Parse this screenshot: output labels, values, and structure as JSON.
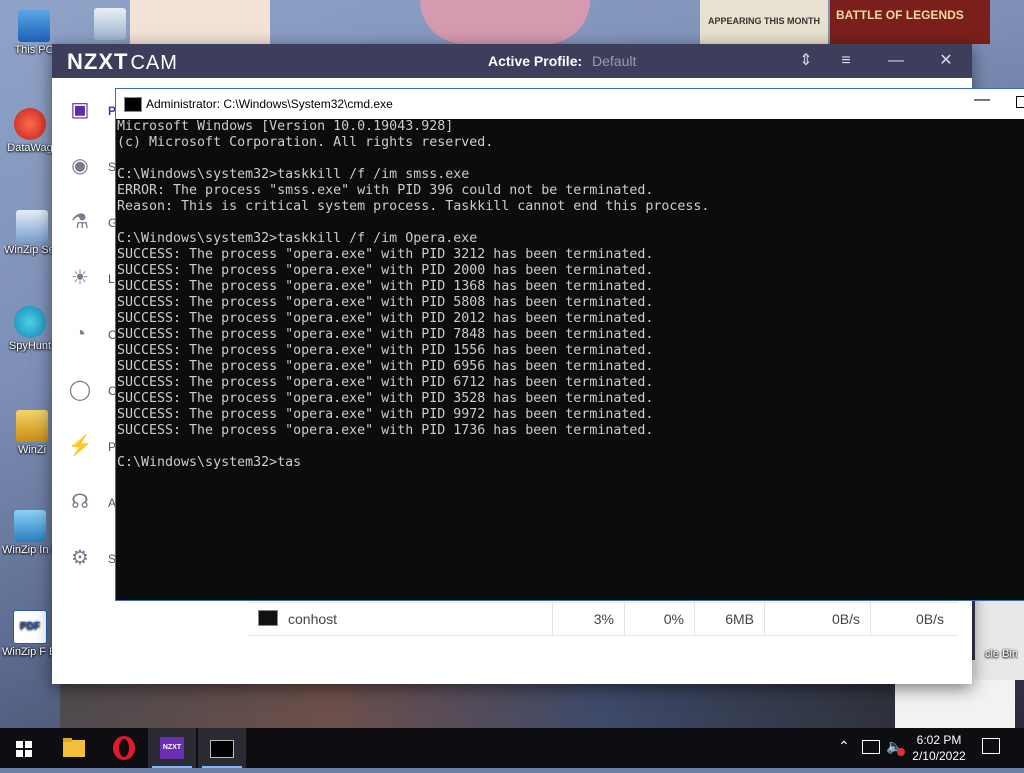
{
  "desktop": {
    "icons": [
      {
        "label": "This PC",
        "name": "this-pc"
      },
      {
        "label": "DataWag",
        "name": "datawag"
      },
      {
        "label": "WinZip Secur",
        "name": "winzip-secure"
      },
      {
        "label": "SpyHunt",
        "name": "spyhunter"
      },
      {
        "label": "WinZi",
        "name": "winzip"
      },
      {
        "label": "WinZip In Manag",
        "name": "winzip-image-manager"
      },
      {
        "label": "WinZip F Expres",
        "name": "winzip-pdf-express"
      }
    ],
    "recycle_bin_label": "cle Bin",
    "wallpaper_text": {
      "appearing": "APPEARING THIS MONTH",
      "battle": "BATTLE OF LEGENDS"
    }
  },
  "nzxt": {
    "logo_brand": "NZXT",
    "logo_app": "CAM",
    "profile_label": "Active Profile:",
    "profile_value": "Default",
    "sidebar_letters": [
      "P",
      "S",
      "G",
      "L",
      "O",
      "C",
      "P",
      "A",
      "S"
    ],
    "process_row": {
      "name": "conhost",
      "cpu": "3%",
      "gpu": "0%",
      "ram": "6MB",
      "read": "0B/s",
      "write": "0B/s"
    }
  },
  "cmd": {
    "title": "Administrator: C:\\Windows\\System32\\cmd.exe",
    "lines": [
      "Microsoft Windows [Version 10.0.19043.928]",
      "(c) Microsoft Corporation. All rights reserved.",
      "",
      "C:\\Windows\\system32>taskkill /f /im smss.exe",
      "ERROR: The process \"smss.exe\" with PID 396 could not be terminated.",
      "Reason: This is critical system process. Taskkill cannot end this process.",
      "",
      "C:\\Windows\\system32>taskkill /f /im Opera.exe",
      "SUCCESS: The process \"opera.exe\" with PID 3212 has been terminated.",
      "SUCCESS: The process \"opera.exe\" with PID 2000 has been terminated.",
      "SUCCESS: The process \"opera.exe\" with PID 1368 has been terminated.",
      "SUCCESS: The process \"opera.exe\" with PID 5808 has been terminated.",
      "SUCCESS: The process \"opera.exe\" with PID 2012 has been terminated.",
      "SUCCESS: The process \"opera.exe\" with PID 7848 has been terminated.",
      "SUCCESS: The process \"opera.exe\" with PID 1556 has been terminated.",
      "SUCCESS: The process \"opera.exe\" with PID 6956 has been terminated.",
      "SUCCESS: The process \"opera.exe\" with PID 6712 has been terminated.",
      "SUCCESS: The process \"opera.exe\" with PID 3528 has been terminated.",
      "SUCCESS: The process \"opera.exe\" with PID 9972 has been terminated.",
      "SUCCESS: The process \"opera.exe\" with PID 1736 has been terminated.",
      "",
      "C:\\Windows\\system32>tas"
    ]
  },
  "taskbar": {
    "apps": [
      "start-button",
      "file-explorer",
      "opera",
      "nzxt-cam",
      "command-prompt"
    ],
    "nzxt_label": "NZXT",
    "time": "6:02 PM",
    "date": "2/10/2022"
  },
  "colors": {
    "nzxt_title_bg": "#3d3e5c",
    "cmd_bg": "#0c0c0c",
    "cmd_text": "#cccccc",
    "taskbar_bg": "#0e0e12",
    "opera_red": "#e2192c",
    "nzxt_purple": "#6b2fb3"
  }
}
